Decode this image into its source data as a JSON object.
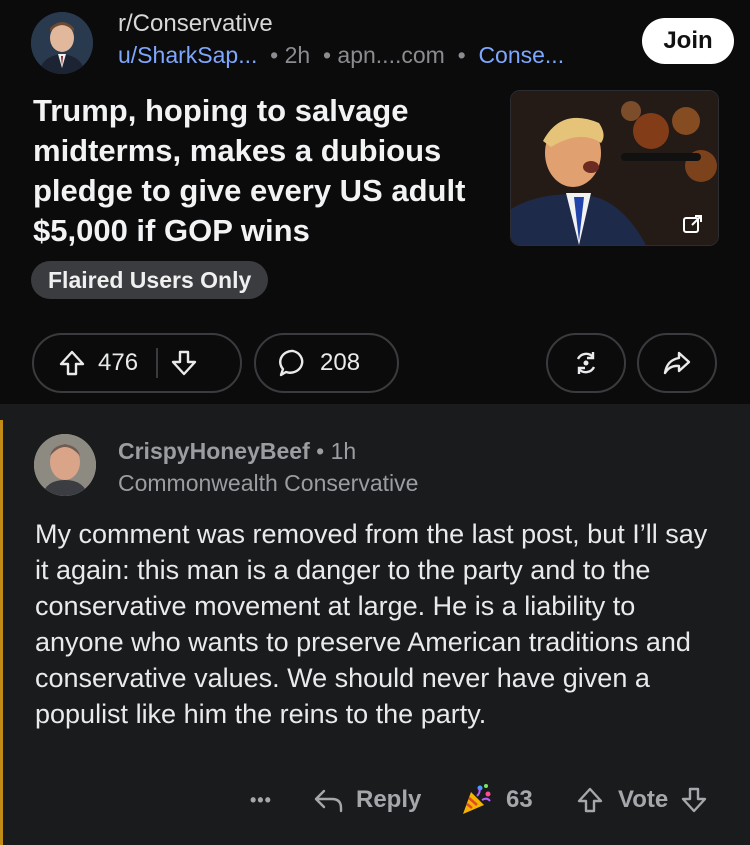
{
  "post": {
    "subreddit": "r/Conservative",
    "author": "u/SharkSap...",
    "age": "2h",
    "domain": "apn....com",
    "flair_short": "Conse...",
    "join_label": "Join",
    "title": "Trump, hoping to salvage midterms, makes a dubious pledge to give every US adult $5,000 if GOP wins",
    "flair": "Flaired Users Only",
    "upvotes": "476",
    "comments": "208"
  },
  "comment": {
    "username": "CrispyHoneyBeef",
    "age": "1h",
    "user_flair": "Commonwealth Conservative",
    "body": "My comment was removed from the last post, but I’ll say it again: this man is a danger to the party and to the conservative movement at large. He is a liability to anyone who wants to preserve American traditions and conservative values. We should never have given a populist like him the reins to the party.",
    "more": "•••",
    "reply_label": "Reply",
    "award_count": "63",
    "vote_label": "Vote"
  },
  "icons": [
    "upvote-icon",
    "downvote-icon",
    "comment-icon",
    "award-icon",
    "share-icon",
    "external-link-icon",
    "reply-icon",
    "party-award-icon"
  ],
  "colors": {
    "accent_link": "#7ea7ff",
    "comment_rail": "#c28b16",
    "background": "#0b0b0c"
  }
}
